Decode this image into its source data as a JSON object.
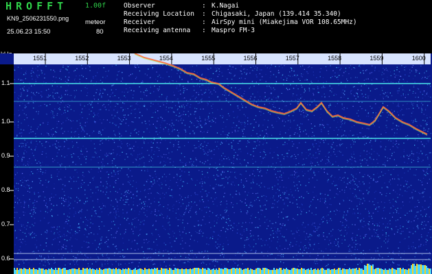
{
  "header": {
    "brand": "HROFFT",
    "version": "1.00f",
    "filename": "KN9_2506231550.png",
    "datetime": "25.06.23 15:50",
    "meteor_label": "meteor",
    "meteor_value": "80"
  },
  "info": [
    {
      "key": "Observer",
      "value": "K.Nagai"
    },
    {
      "key": "Receiving Location",
      "value": "Chigasaki, Japan (139.414 35.340)"
    },
    {
      "key": "Receiver",
      "value": "AirSpy mini (Miakejima VOR 108.65MHz)"
    },
    {
      "key": "Receiving antenna",
      "value": "Maspro FM-3"
    }
  ],
  "spectrogram": {
    "freq_unit": "kHz",
    "time_ticks": [
      "1551",
      "1552",
      "1553",
      "1554",
      "1555",
      "1556",
      "1557",
      "1558",
      "1559",
      "1600"
    ],
    "freq_ticks": [
      "1.1",
      "1.0",
      "0.9",
      "0.8",
      "0.7",
      "0.6"
    ],
    "background_color": "#0a1a8a",
    "signal_color": "#ff6a3a",
    "line_color": "#4ff0f0",
    "status_color": "#ffd21a"
  }
}
